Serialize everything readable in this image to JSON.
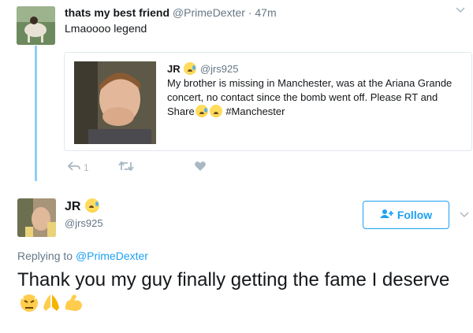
{
  "parent_tweet": {
    "name": "thats my best friend",
    "handle": "@PrimeDexter",
    "separator": "·",
    "time": "47m",
    "text": "Lmaoooo legend"
  },
  "quoted_tweet": {
    "name": "JR",
    "handle": "@jrs925",
    "text_main": "My brother is missing in Manchester, was at the Ariana Grande concert, no contact since the bomb went off. Please RT and Share",
    "hashtag": "#Manchester"
  },
  "actions": {
    "reply_count": "1",
    "retweet_count": "",
    "like_count": ""
  },
  "reply_tweet": {
    "name": "JR",
    "handle": "@jrs925",
    "follow_label": "Follow",
    "replying_prefix": "Replying to",
    "replying_to": "@PrimeDexter",
    "text": "Thank you my guy finally getting the fame I deserve"
  },
  "icons": {
    "reply": "reply-icon",
    "retweet": "retweet-icon",
    "like": "heart-icon",
    "follow": "add-user-icon",
    "caret": "chevron-down-icon"
  },
  "colors": {
    "accent": "#1da1f2",
    "thread_line": "#8fd0f1",
    "muted": "#657786",
    "icon_gray": "#aab8c2"
  }
}
